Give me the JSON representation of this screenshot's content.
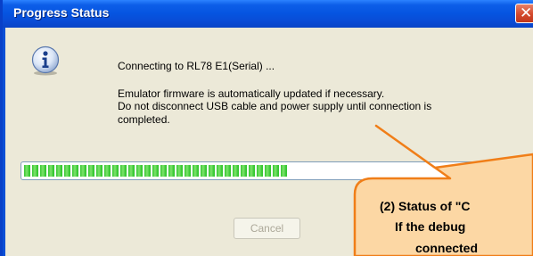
{
  "window": {
    "title": "Progress Status",
    "close_glyph": "✕"
  },
  "message": {
    "icon": "info-icon",
    "line1": "Connecting to RL78 E1(Serial) ...",
    "line2": "Emulator firmware is automatically updated if necessary.",
    "line3": "Do not disconnect USB cable and power supply until connection is",
    "line4": "completed."
  },
  "progress": {
    "value_fraction": 0.5
  },
  "buttons": {
    "cancel_label": "Cancel",
    "cancel_enabled": false
  },
  "callout": {
    "line1": "(2) Status of \"C",
    "line2": "If the debug",
    "line3": "connected",
    "fill_color": "#fcd7a4",
    "border_color": "#f07e18"
  }
}
